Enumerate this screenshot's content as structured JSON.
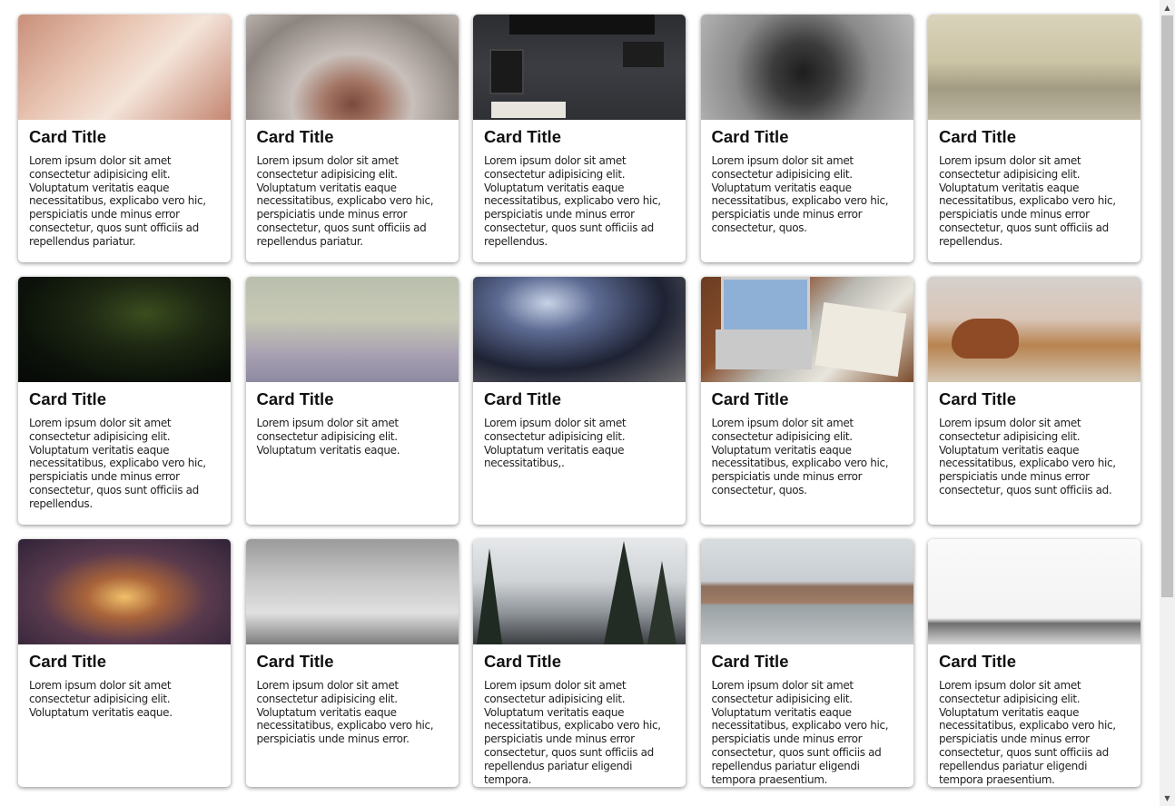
{
  "cards": [
    {
      "image": "desk-workspace-photo",
      "title": "Card Title",
      "text": "Lorem ipsum dolor sit amet consectetur adipisicing elit. Voluptatum veritatis eaque necessitatibus, explicabo vero hic, perspiciatis unde minus error consectetur, quos sunt officiis ad repellendus pariatur."
    },
    {
      "image": "cat-nose-photo",
      "title": "Card Title",
      "text": "Lorem ipsum dolor sit amet consectetur adipisicing elit. Voluptatum veritatis eaque necessitatibus, explicabo vero hic, perspiciatis unde minus error consectetur, quos sunt officiis ad repellendus pariatur."
    },
    {
      "image": "tech-flatlay-photo",
      "title": "Card Title",
      "text": "Lorem ipsum dolor sit amet consectetur adipisicing elit. Voluptatum veritatis eaque necessitatibus, explicabo vero hic, perspiciatis unde minus error consectetur, quos sunt officiis ad repellendus."
    },
    {
      "image": "pinecones-photo",
      "title": "Card Title",
      "text": "Lorem ipsum dolor sit amet consectetur adipisicing elit. Voluptatum veritatis eaque necessitatibus, explicabo vero hic, perspiciatis unde minus error consectetur, quos."
    },
    {
      "image": "beach-photo",
      "title": "Card Title",
      "text": "Lorem ipsum dolor sit amet consectetur adipisicing elit. Voluptatum veritatis eaque necessitatibus, explicabo vero hic, perspiciatis unde minus error consectetur, quos sunt officiis ad repellendus."
    },
    {
      "image": "night-sky-photo",
      "title": "Card Title",
      "text": "Lorem ipsum dolor sit amet consectetur adipisicing elit. Voluptatum veritatis eaque necessitatibus, explicabo vero hic, perspiciatis unde minus error consectetur, quos sunt officiis ad repellendus."
    },
    {
      "image": "bare-tree-photo",
      "title": "Card Title",
      "text": "Lorem ipsum dolor sit amet consectetur adipisicing elit. Voluptatum veritatis eaque."
    },
    {
      "image": "phone-photo",
      "title": "Card Title",
      "text": "Lorem ipsum dolor sit amet consectetur adipisicing elit. Voluptatum veritatis eaque necessitatibus,."
    },
    {
      "image": "laptop-notebook-photo",
      "title": "Card Title",
      "text": "Lorem ipsum dolor sit amet consectetur adipisicing elit. Voluptatum veritatis eaque necessitatibus, explicabo vero hic, perspiciatis unde minus error consectetur, quos."
    },
    {
      "image": "highland-cow-photo",
      "title": "Card Title",
      "text": "Lorem ipsum dolor sit amet consectetur adipisicing elit. Voluptatum veritatis eaque necessitatibus, explicabo vero hic, perspiciatis unde minus error consectetur, quos sunt officiis ad."
    },
    {
      "image": "foggy-road-photo",
      "title": "Card Title",
      "text": "Lorem ipsum dolor sit amet consectetur adipisicing elit. Voluptatum veritatis eaque."
    },
    {
      "image": "stairs-photo",
      "title": "Card Title",
      "text": "Lorem ipsum dolor sit amet consectetur adipisicing elit. Voluptatum veritatis eaque necessitatibus, explicabo vero hic, perspiciatis unde minus error."
    },
    {
      "image": "snowy-mountain-photo",
      "title": "Card Title",
      "text": "Lorem ipsum dolor sit amet consectetur adipisicing elit. Voluptatum veritatis eaque necessitatibus, explicabo vero hic, perspiciatis unde minus error consectetur, quos sunt officiis ad repellendus pariatur eligendi tempora."
    },
    {
      "image": "rock-breakwater-photo",
      "title": "Card Title",
      "text": "Lorem ipsum dolor sit amet consectetur adipisicing elit. Voluptatum veritatis eaque necessitatibus, explicabo vero hic, perspiciatis unde minus error consectetur, quos sunt officiis ad repellendus pariatur eligendi tempora praesentium."
    },
    {
      "image": "white-field-photo",
      "title": "Card Title",
      "text": "Lorem ipsum dolor sit amet consectetur adipisicing elit. Voluptatum veritatis eaque necessitatibus, explicabo vero hic, perspiciatis unde minus error consectetur, quos sunt officiis ad repellendus pariatur eligendi tempora praesentium."
    }
  ],
  "scrollbar": {
    "up_arrow": "▲",
    "down_arrow": "▼"
  }
}
